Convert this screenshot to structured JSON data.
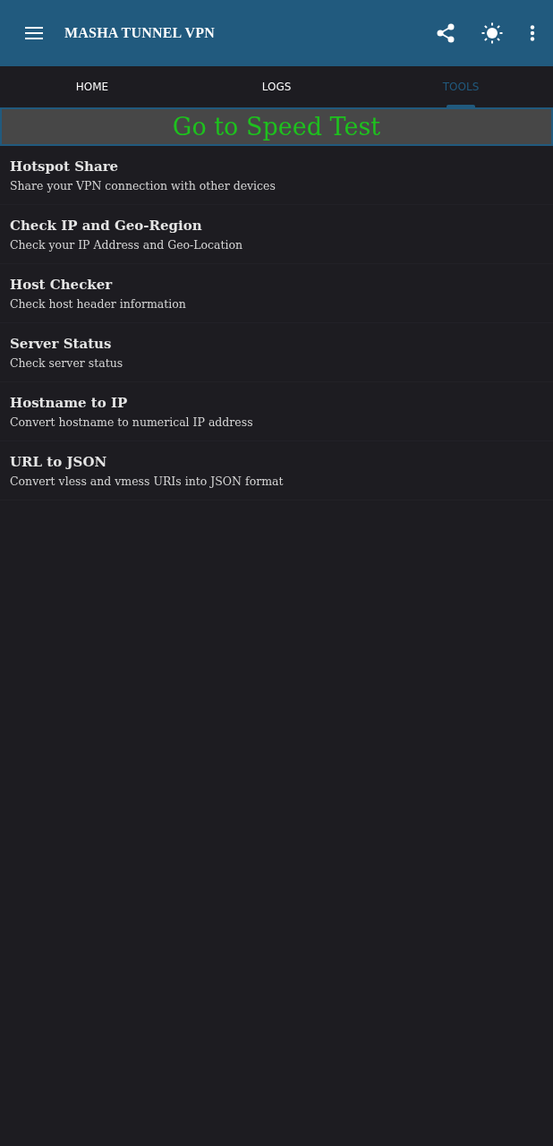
{
  "app_bar": {
    "title": "MASHA TUNNEL VPN"
  },
  "tabs": [
    {
      "label": "HOME",
      "selected": false
    },
    {
      "label": "LOGS",
      "selected": false
    },
    {
      "label": "TOOLS",
      "selected": true
    }
  ],
  "speed_test_button": "Go to Speed Test",
  "tools": [
    {
      "title": "Hotspot Share",
      "subtitle": "Share your VPN connection with other devices"
    },
    {
      "title": "Check IP and Geo-Region",
      "subtitle": "Check your IP Address and Geo-Location"
    },
    {
      "title": "Host Checker",
      "subtitle": "Check host header information"
    },
    {
      "title": "Server Status",
      "subtitle": "Check server status"
    },
    {
      "title": "Hostname to IP",
      "subtitle": "Convert hostname to numerical IP address"
    },
    {
      "title": "URL to JSON",
      "subtitle": "Convert vless and vmess URIs into JSON format"
    }
  ]
}
